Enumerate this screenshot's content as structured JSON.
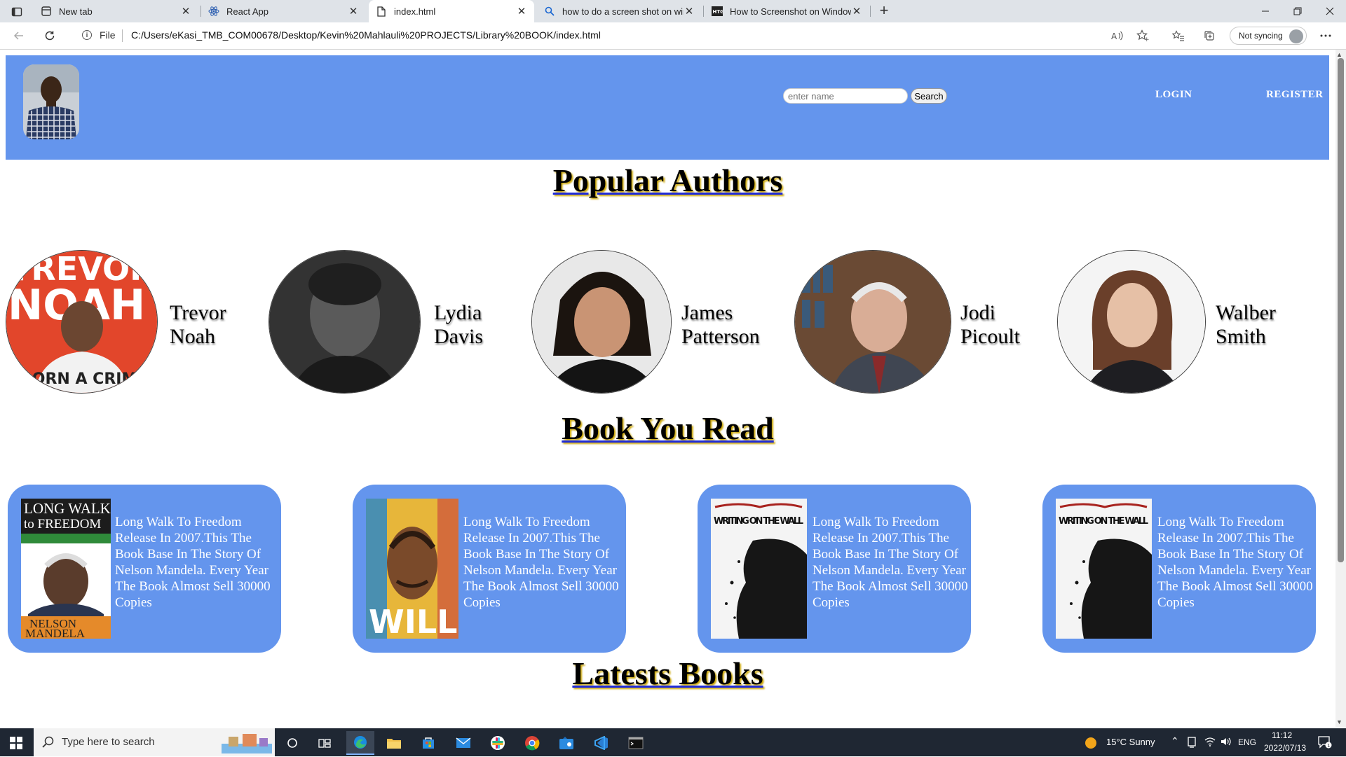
{
  "browser": {
    "tabs": [
      {
        "label": "New tab",
        "icon": "newtab-icon",
        "active": false
      },
      {
        "label": "React App",
        "icon": "react-icon",
        "active": false
      },
      {
        "label": "index.html",
        "icon": "file-icon",
        "active": true
      },
      {
        "label": "how to do a screen shot on wind",
        "icon": "search-icon",
        "active": false
      },
      {
        "label": "How to Screenshot on Windows",
        "icon": "htg-icon",
        "active": false
      }
    ],
    "close_glyph": "✕",
    "new_tab_glyph": "+",
    "file_label": "File",
    "url": "C:/Users/eKasi_TMB_COM00678/Desktop/Kevin%20Mahlauli%20PROJECTS/Library%20BOOK/index.html",
    "sync_label": "Not syncing"
  },
  "page": {
    "header": {
      "search_placeholder": "enter name",
      "search_button": "Search",
      "login_label": "LOGIN",
      "register_label": "REGISTER",
      "color": "#6495ed"
    },
    "popular_authors_title": "Popular Authors",
    "authors": [
      {
        "first": "Trevor",
        "last": "Noah"
      },
      {
        "first": "Lydia",
        "last": "Davis"
      },
      {
        "first": "James",
        "last": "Patterson"
      },
      {
        "first": "Jodi",
        "last": "Picoult"
      },
      {
        "first": "Walber",
        "last": "Smith"
      }
    ],
    "books_title": "Book You Read",
    "books": [
      {
        "description": "Long Walk To Freedom Release In 2007.This The Book Base In The Story Of Nelson Mandela. Every Year The Book Almost Sell 30000 Copies",
        "cover": {
          "top": "LONG WALK",
          "mid": "to FREEDOM",
          "bottom1": "NELSON",
          "bottom2": "MANDELA"
        }
      },
      {
        "description": "Long Walk To Freedom Release In 2007.This The Book Base In The Story Of Nelson Mandela. Every Year The Book Almost Sell 30000 Copies",
        "cover": {
          "word": "WILL"
        }
      },
      {
        "description": "Long Walk To Freedom Release In 2007.This The Book Base In The Story Of Nelson Mandela. Every Year The Book Almost Sell 30000 Copies",
        "cover": {
          "title": "WRITING ON THE WALL"
        }
      },
      {
        "description": "Long Walk To Freedom Release In 2007.This The Book Base In The Story Of Nelson Mandela. Every Year The Book Almost Sell 30000 Copies",
        "cover": {
          "title": "WRITING ON THE WALL"
        }
      }
    ],
    "latest_title": "Latests Books"
  },
  "taskbar": {
    "search_placeholder": "Type here to search",
    "weather": "15°C  Sunny",
    "language": "ENG",
    "time": "11:12",
    "date": "2022/07/13"
  }
}
